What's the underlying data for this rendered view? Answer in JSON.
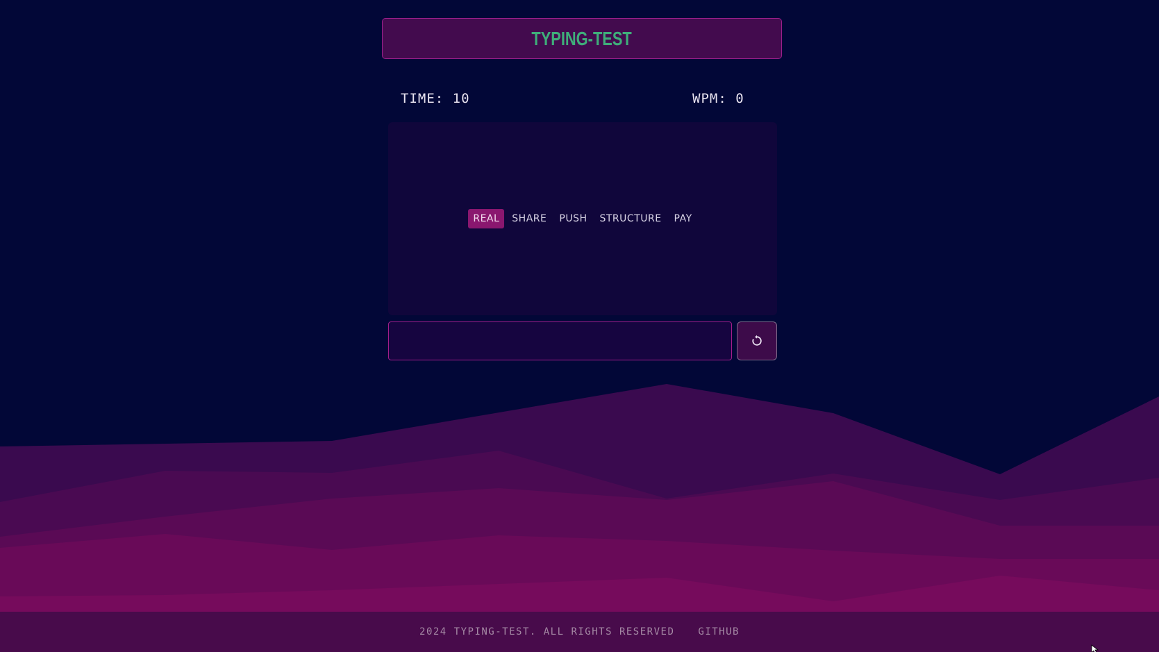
{
  "header": {
    "title": "TYPING-TEST"
  },
  "stats": {
    "time_label": "TIME: 10",
    "wpm_label": "WPM: 0",
    "time_value": 10,
    "wpm_value": 0
  },
  "words": {
    "items": [
      "REAL",
      "SHARE",
      "PUSH",
      "STRUCTURE",
      "PAY"
    ],
    "active_index": 0
  },
  "input": {
    "value": "",
    "placeholder": ""
  },
  "restart_button": {
    "icon": "restart-icon"
  },
  "footer": {
    "copyright": "2024 TYPING-TEST. ALL RIGHTS RESERVED",
    "github_label": "GITHUB"
  },
  "colors": {
    "background": "#020737",
    "title_accent": "#3fae7a",
    "active_word": "#8a176f",
    "border_accent": "#a31d8d"
  }
}
